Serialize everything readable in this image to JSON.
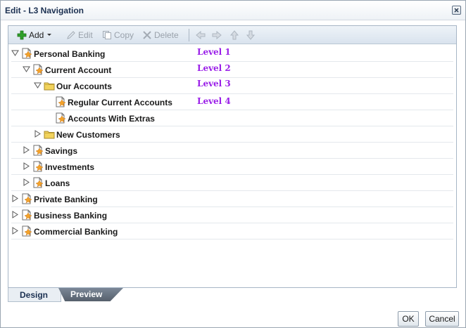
{
  "window": {
    "title": "Edit - L3 Navigation"
  },
  "toolbar": {
    "add_label": "Add",
    "edit_label": "Edit",
    "copy_label": "Copy",
    "delete_label": "Delete"
  },
  "tree": {
    "nodes": [
      {
        "label": "Personal Banking",
        "level": 1,
        "state": "expanded",
        "icon": "page-icon"
      },
      {
        "label": "Current Account",
        "level": 2,
        "state": "expanded",
        "icon": "page-icon"
      },
      {
        "label": "Our Accounts",
        "level": 3,
        "state": "expanded",
        "icon": "folder-icon"
      },
      {
        "label": "Regular Current Accounts",
        "level": 4,
        "state": "leaf",
        "icon": "page-icon"
      },
      {
        "label": "Accounts With Extras",
        "level": 4,
        "state": "leaf",
        "icon": "page-icon"
      },
      {
        "label": "New Customers",
        "level": 3,
        "state": "collapsed",
        "icon": "folder-icon"
      },
      {
        "label": "Savings",
        "level": 2,
        "state": "collapsed",
        "icon": "page-icon"
      },
      {
        "label": "Investments",
        "level": 2,
        "state": "collapsed",
        "icon": "page-icon"
      },
      {
        "label": "Loans",
        "level": 2,
        "state": "collapsed",
        "icon": "page-icon"
      },
      {
        "label": "Private Banking",
        "level": 1,
        "state": "collapsed",
        "icon": "page-icon"
      },
      {
        "label": "Business Banking",
        "level": 1,
        "state": "collapsed",
        "icon": "page-icon"
      },
      {
        "label": "Commercial Banking",
        "level": 1,
        "state": "collapsed",
        "icon": "page-icon"
      }
    ]
  },
  "annotations": {
    "level1": "Level 1",
    "level2": "Level 2",
    "level3": "Level 3",
    "level4": "Level 4"
  },
  "tabs": {
    "design": "Design",
    "preview": "Preview"
  },
  "footer": {
    "ok": "OK",
    "cancel": "Cancel"
  },
  "colors": {
    "annotation": "#9a1fe8",
    "add_icon": "#2fa12a",
    "folder": "#f2d35c"
  }
}
